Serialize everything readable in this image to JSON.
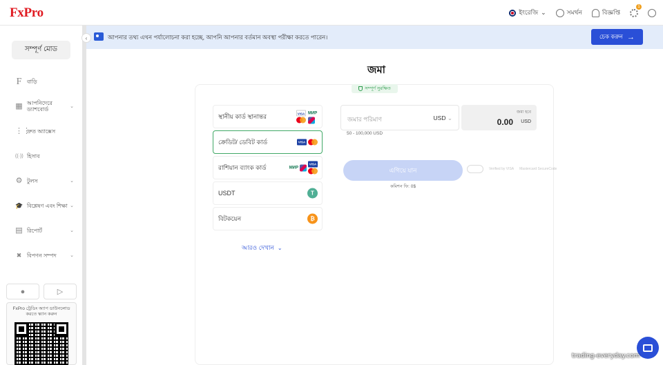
{
  "brand": {
    "logo": "FxPro"
  },
  "topbar": {
    "language": "ইংরেজি",
    "support": "সমর্থন",
    "notifications": "বিজ্ঞপ্তি",
    "settings_badge": "1"
  },
  "sidebar": {
    "mode_button": "সম্পূর্ণ মোড",
    "items": [
      {
        "icon": "F",
        "label": "বাড়ি",
        "chevron": false
      },
      {
        "icon": "▦",
        "label": "আপনিদেরে ড্যাশবোর্ড",
        "chevron": true
      },
      {
        "icon": "⋮⋮",
        "label": "দ্রুত অ্যাক্সেস",
        "chevron": false
      },
      {
        "icon": "((·))",
        "label": "হিসাব",
        "chevron": false
      },
      {
        "icon": "⚙",
        "label": "টুলস",
        "chevron": true
      },
      {
        "icon": "🎓",
        "label": "বিশ্লেষণ এবং শিক্ষা",
        "chevron": true
      },
      {
        "icon": "▤",
        "label": "রিপোর্ট",
        "chevron": true
      },
      {
        "icon": "✖",
        "label": "বিপণন সম্পদ",
        "chevron": true
      }
    ],
    "qr_text": "FxPro ট্রেডিং অ্যাপ ডাউনলোড করতে স্ক্যান করুন"
  },
  "notice": {
    "text": "আপনার তথ্য এখন পর্যালোচনা করা হচ্ছে, আপনি আপনার বর্তমান অবস্থা পরীক্ষা করতে পারেন।",
    "button": "চেক করুন"
  },
  "main": {
    "title": "জমা",
    "secure_label": "সম্পূর্ণ সুরক্ষিত",
    "methods": [
      {
        "label": "স্থানীয় কার্ড স্থানান্তর",
        "selected": false
      },
      {
        "label": "ক্রেডিট/ ডেবিট কার্ড",
        "selected": true
      },
      {
        "label": "রাশিয়ান ব্যাংক কার্ড",
        "selected": false
      },
      {
        "label": "USDT",
        "selected": false
      },
      {
        "label": "বিটকয়েন",
        "selected": false
      }
    ],
    "logo_texts": {
      "visa": "VISA",
      "mir": "МИР",
      "usdt": "T",
      "btc": "₿"
    },
    "show_more": "আরও দেখান",
    "amount_placeholder": "জমার পরিমাণ",
    "amount_currency": "USD",
    "range": "50 - 100,000 USD",
    "receive_label": "জমা হবে",
    "receive_value": "0.00",
    "receive_currency": "USD",
    "continue_button": "এগিয়ে যান",
    "fee": "কমিশন ফি: 0$",
    "trust": [
      "Verified by VISA",
      "Mastercard SecureCode"
    ]
  },
  "watermark": "trading-everyday.com",
  "colors": {
    "brand_red": "#e01b22",
    "accent_blue": "#2a4fd7",
    "selected_green": "#3fa865"
  }
}
